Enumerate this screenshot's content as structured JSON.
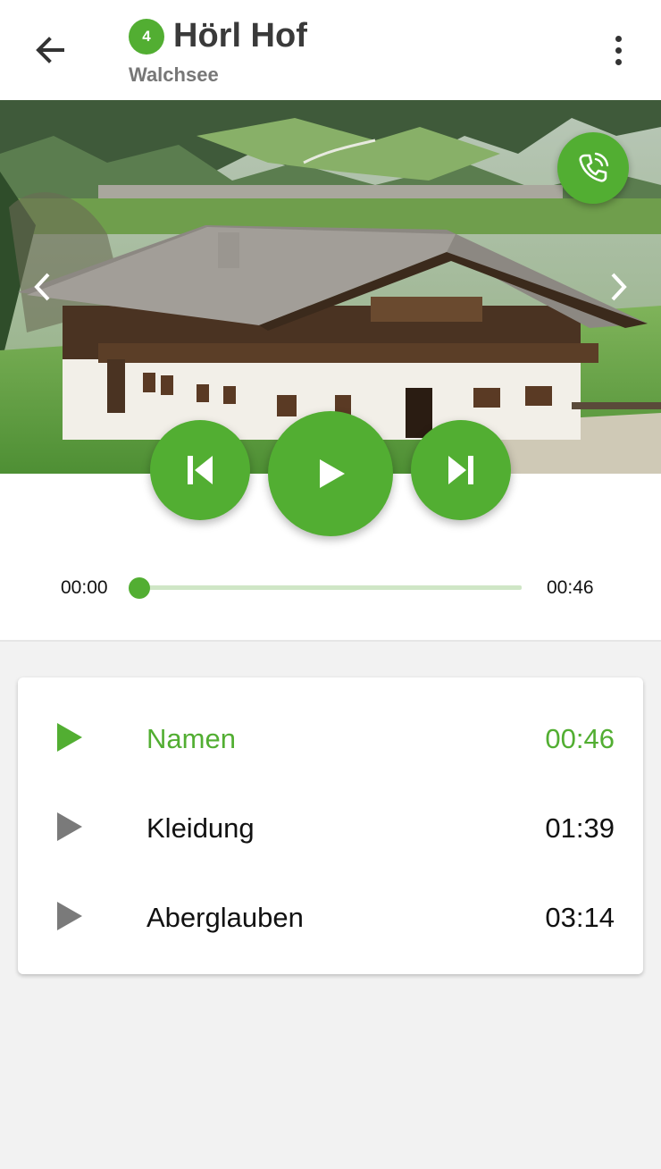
{
  "header": {
    "badge": "4",
    "title": "Hörl Hof",
    "subtitle": "Walchsee",
    "back_icon": "arrow-left-icon",
    "menu_icon": "more-vert-icon"
  },
  "hero": {
    "call_icon": "phone-icon",
    "prev_icon": "chevron-left-icon",
    "next_icon": "chevron-right-icon"
  },
  "player": {
    "current_time": "00:00",
    "total_time": "00:46",
    "progress": 0,
    "prev_icon": "skip-previous-icon",
    "play_icon": "play-icon",
    "next_icon": "skip-next-icon"
  },
  "tracks": [
    {
      "title": "Namen",
      "duration": "00:46",
      "active": true
    },
    {
      "title": "Kleidung",
      "duration": "01:39",
      "active": false
    },
    {
      "title": "Aberglauben",
      "duration": "03:14",
      "active": false
    }
  ],
  "colors": {
    "accent": "#52ae32",
    "track_bg": "#cfe6c6",
    "inactive_icon": "#7a7a7a"
  }
}
